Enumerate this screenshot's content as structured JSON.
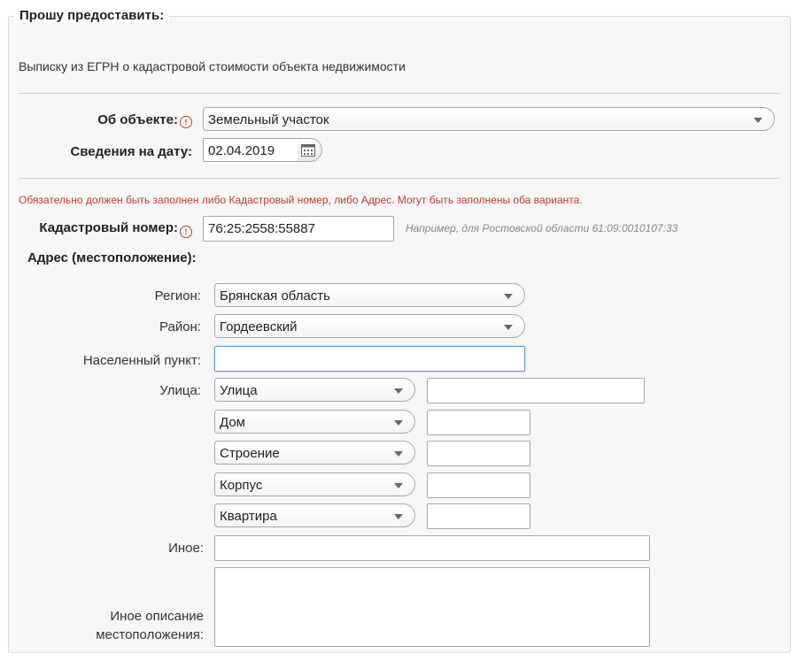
{
  "form": {
    "legend": "Прошу предоставить:",
    "description": "Выписку из ЕГРН о кадастровой стоимости объекта недвижимости",
    "object": {
      "label": "Об объекте:",
      "value": "Земельный участок"
    },
    "date": {
      "label": "Сведения на дату:",
      "value": "02.04.2019"
    },
    "required_note": "Обязательно должен быть заполнен либо Кадастровый номер, либо Адрес. Могут быть заполнены оба варианта.",
    "cadastral": {
      "label": "Кадастровый номер:",
      "value": "76:25:2558:55887",
      "hint": "Например, для Ростовской области 61:09:0010107:33"
    },
    "address": {
      "heading": "Адрес (местоположение):",
      "region": {
        "label": "Регион:",
        "value": "Брянская область"
      },
      "district": {
        "label": "Район:",
        "value": "Гордеевский"
      },
      "settlement": {
        "label": "Населенный пункт:",
        "value": ""
      },
      "street": {
        "label": "Улица:",
        "type": "Улица",
        "value": ""
      },
      "house": {
        "type": "Дом",
        "value": ""
      },
      "building": {
        "type": "Строение",
        "value": ""
      },
      "block": {
        "type": "Корпус",
        "value": ""
      },
      "apartment": {
        "type": "Квартира",
        "value": ""
      },
      "other": {
        "label": "Иное:",
        "value": ""
      },
      "other_desc": {
        "label_line1": "Иное описание",
        "label_line2": "местоположения:",
        "value": ""
      }
    },
    "required_icon": "!"
  }
}
